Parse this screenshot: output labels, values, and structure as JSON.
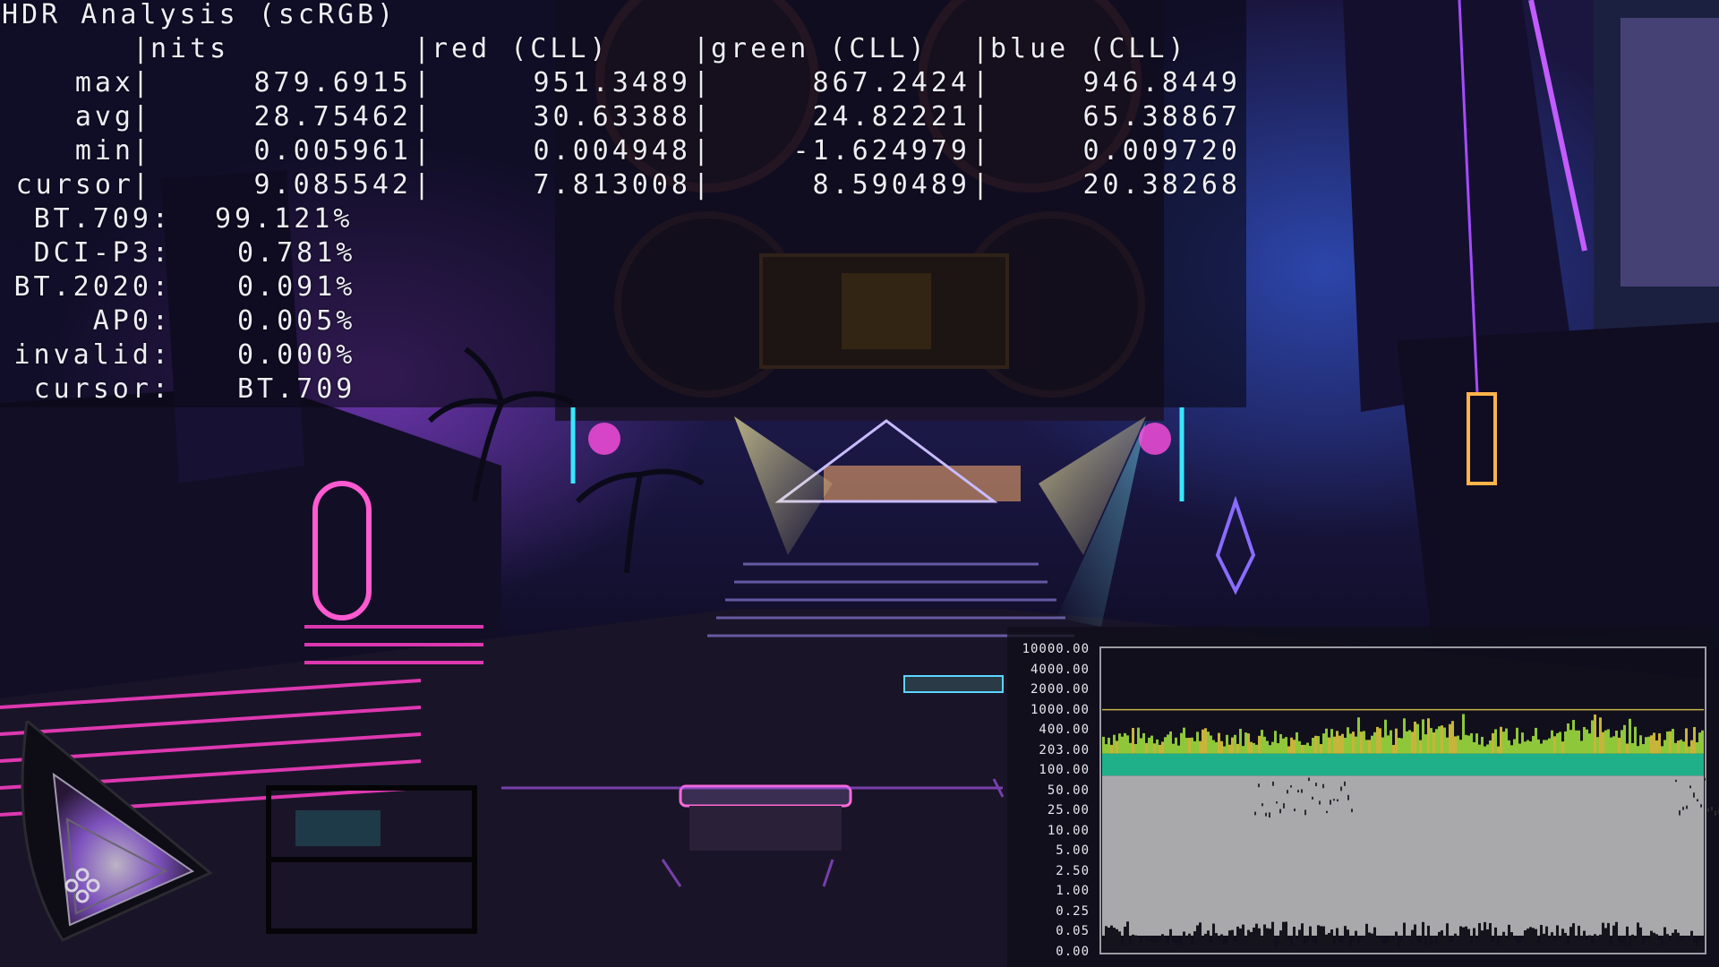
{
  "hud": {
    "title": "HDR Analysis (scRGB)",
    "columns": [
      "nits",
      "red (CLL)",
      "green (CLL)",
      "blue (CLL)"
    ],
    "rows": [
      {
        "label": "max",
        "values": [
          "879.6915",
          "951.3489",
          "867.2424",
          "946.8449"
        ]
      },
      {
        "label": "avg",
        "values": [
          "28.75462",
          "30.63388",
          "24.82221",
          "65.38867"
        ]
      },
      {
        "label": "min",
        "values": [
          "0.005961",
          "0.004948",
          "-1.624979",
          "0.009720"
        ]
      },
      {
        "label": "cursor",
        "values": [
          "9.085542",
          "7.813008",
          "8.590489",
          "20.38268"
        ]
      }
    ],
    "gamut": [
      {
        "label": "BT.709:",
        "value": "99.121%"
      },
      {
        "label": "DCI-P3:",
        "value": "0.781%"
      },
      {
        "label": "BT.2020:",
        "value": "0.091%"
      },
      {
        "label": "AP0:",
        "value": "0.005%"
      },
      {
        "label": "invalid:",
        "value": "0.000%"
      },
      {
        "label": "cursor:",
        "value": "BT.709"
      }
    ]
  },
  "luminance_graph": {
    "y_ticks": [
      "10000.00",
      "4000.00",
      "2000.00",
      "1000.00",
      "400.00",
      "203.00",
      "100.00",
      "50.00",
      "25.00",
      "10.00",
      "5.00",
      "2.50",
      "1.00",
      "0.25",
      "0.05",
      "0.00"
    ],
    "colors": {
      "upper": "#8fc73a",
      "mid": "#1fb08a",
      "fill": "#a9a9ab"
    }
  },
  "colors": {
    "neon_pink": "#ff3fc8",
    "neon_purple": "#9a3cff",
    "neon_cyan": "#36e8ff",
    "spot_yellow": "#ffe86a"
  }
}
